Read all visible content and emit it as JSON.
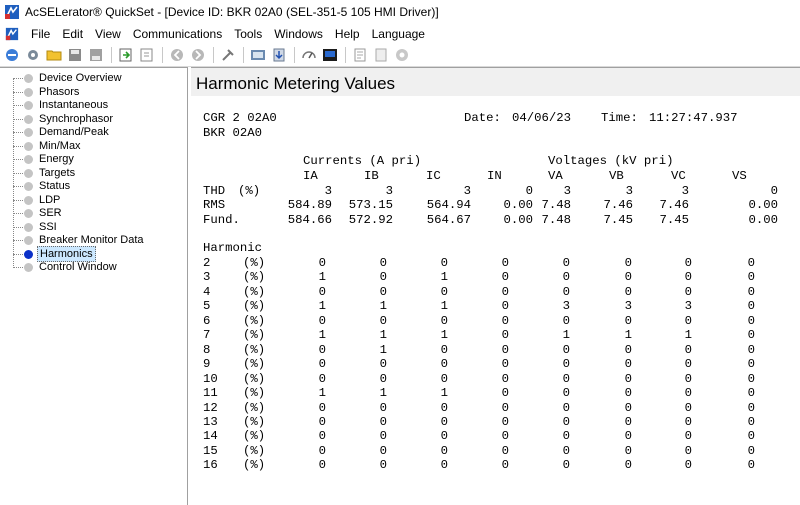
{
  "window": {
    "title": "AcSELerator® QuickSet - [Device ID: BKR 02A0 (SEL-351-5 105 HMI Driver)]"
  },
  "menu": [
    "File",
    "Edit",
    "View",
    "Communications",
    "Tools",
    "Windows",
    "Help",
    "Language"
  ],
  "toolbar_icons": [
    "connect-icon",
    "settings-icon",
    "open-folder-icon",
    "save-icon",
    "save-all-icon",
    "import-icon",
    "export-icon",
    "back-icon",
    "forward-icon",
    "tools-icon",
    "terminal-icon",
    "download-icon",
    "meter-icon",
    "hmi-icon",
    "report-icon",
    "page-icon",
    "help-icon"
  ],
  "tree": {
    "selected": "Harmonics",
    "items": [
      "Device Overview",
      "Phasors",
      "Instantaneous",
      "Synchrophasor",
      "Demand/Peak",
      "Min/Max",
      "Energy",
      "Targets",
      "Status",
      "LDP",
      "SER",
      "SSI",
      "Breaker Monitor Data",
      "Harmonics",
      "Control Window"
    ]
  },
  "panel": {
    "title": "Harmonic Metering Values",
    "header": {
      "line1": "CGR 2 02A0",
      "line2": "BKR 02A0",
      "date_label": "Date:",
      "date": "04/06/23",
      "time_label": "Time:",
      "time": "11:27:47.937"
    },
    "group_labels": {
      "currents": "Currents (A pri)",
      "voltages": "Voltages (kV pri)"
    },
    "columns": [
      "IA",
      "IB",
      "IC",
      "IN",
      "VA",
      "VB",
      "VC",
      "VS"
    ],
    "summary_rows": [
      {
        "label": "THD",
        "unit": "(%)",
        "values": [
          "3",
          "3",
          "3",
          "0",
          "3",
          "3",
          "3",
          "0"
        ]
      },
      {
        "label": "RMS",
        "unit": "",
        "values": [
          "584.89",
          "573.15",
          "564.94",
          "0.00",
          "7.48",
          "7.46",
          "7.46",
          "0.00"
        ]
      },
      {
        "label": "Fund.",
        "unit": "",
        "values": [
          "584.66",
          "572.92",
          "564.67",
          "0.00",
          "7.48",
          "7.45",
          "7.45",
          "0.00"
        ]
      }
    ],
    "harmonic_label": "Harmonic",
    "harmonic_rows": [
      {
        "n": "2",
        "unit": "(%)",
        "values": [
          "0",
          "0",
          "0",
          "0",
          "0",
          "0",
          "0",
          "0"
        ]
      },
      {
        "n": "3",
        "unit": "(%)",
        "values": [
          "1",
          "0",
          "1",
          "0",
          "0",
          "0",
          "0",
          "0"
        ]
      },
      {
        "n": "4",
        "unit": "(%)",
        "values": [
          "0",
          "0",
          "0",
          "0",
          "0",
          "0",
          "0",
          "0"
        ]
      },
      {
        "n": "5",
        "unit": "(%)",
        "values": [
          "1",
          "1",
          "1",
          "0",
          "3",
          "3",
          "3",
          "0"
        ]
      },
      {
        "n": "6",
        "unit": "(%)",
        "values": [
          "0",
          "0",
          "0",
          "0",
          "0",
          "0",
          "0",
          "0"
        ]
      },
      {
        "n": "7",
        "unit": "(%)",
        "values": [
          "1",
          "1",
          "1",
          "0",
          "1",
          "1",
          "1",
          "0"
        ]
      },
      {
        "n": "8",
        "unit": "(%)",
        "values": [
          "0",
          "1",
          "0",
          "0",
          "0",
          "0",
          "0",
          "0"
        ]
      },
      {
        "n": "9",
        "unit": "(%)",
        "values": [
          "0",
          "0",
          "0",
          "0",
          "0",
          "0",
          "0",
          "0"
        ]
      },
      {
        "n": "10",
        "unit": "(%)",
        "values": [
          "0",
          "0",
          "0",
          "0",
          "0",
          "0",
          "0",
          "0"
        ]
      },
      {
        "n": "11",
        "unit": "(%)",
        "values": [
          "1",
          "1",
          "1",
          "0",
          "0",
          "0",
          "0",
          "0"
        ]
      },
      {
        "n": "12",
        "unit": "(%)",
        "values": [
          "0",
          "0",
          "0",
          "0",
          "0",
          "0",
          "0",
          "0"
        ]
      },
      {
        "n": "13",
        "unit": "(%)",
        "values": [
          "0",
          "0",
          "0",
          "0",
          "0",
          "0",
          "0",
          "0"
        ]
      },
      {
        "n": "14",
        "unit": "(%)",
        "values": [
          "0",
          "0",
          "0",
          "0",
          "0",
          "0",
          "0",
          "0"
        ]
      },
      {
        "n": "15",
        "unit": "(%)",
        "values": [
          "0",
          "0",
          "0",
          "0",
          "0",
          "0",
          "0",
          "0"
        ]
      },
      {
        "n": "16",
        "unit": "(%)",
        "values": [
          "0",
          "0",
          "0",
          "0",
          "0",
          "0",
          "0",
          "0"
        ]
      }
    ]
  }
}
